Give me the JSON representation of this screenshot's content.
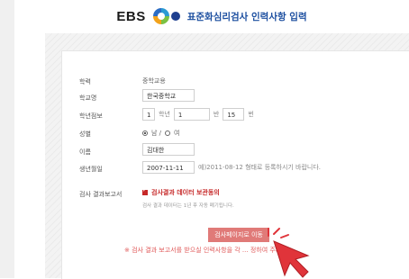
{
  "header": {
    "logo_text": "EBS",
    "title": "표준화심리검사 인력사항 입력"
  },
  "form": {
    "level": {
      "label": "학력",
      "value": "중학교용"
    },
    "school": {
      "label": "학교명",
      "value": "한국중학교"
    },
    "class_info": {
      "label": "학년점보",
      "grade_value": "1",
      "grade_suffix": "학년",
      "class_value": "1",
      "class_suffix": "반",
      "number_value": "15",
      "number_suffix": "번"
    },
    "gender": {
      "label": "성별",
      "male": "남 /",
      "female": "여"
    },
    "name": {
      "label": "이름",
      "value": "김대한"
    },
    "birth": {
      "label": "생년월일",
      "value": "2007-11-11",
      "hint": "예)2011-08-12 형태로 등록하시기 바랍니다."
    },
    "report": {
      "label": "검사 결과보고서",
      "consent_label": "검사결과 데이터 보관동의",
      "consent_sub": "검사 결과 데이터는 1년 후 자동 폐기됩니다."
    }
  },
  "actions": {
    "go_button": "검사페이지로 이동",
    "notice": "※ 검사 결과 보고서를 받으실 인력사항을 각 ... 정하여 주세요."
  },
  "colors": {
    "brand_blue": "#1d4fa0",
    "accent_red": "#c62828",
    "button_pink": "#e07a78"
  }
}
